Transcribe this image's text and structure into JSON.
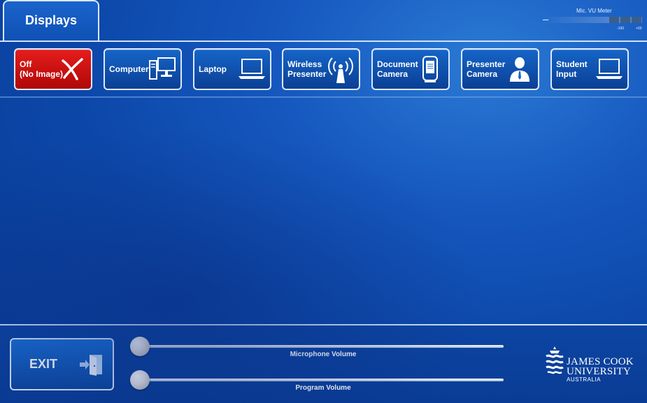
{
  "header": {
    "tab_label": "Displays"
  },
  "vu_meter": {
    "title": "Mic. VU Meter",
    "scale_labels": [
      "-100",
      "+00"
    ]
  },
  "sources": [
    {
      "label": "Off\n(No Image)",
      "icon": "x-icon",
      "active": true
    },
    {
      "label": "Computer",
      "icon": "desktop-computer-icon",
      "active": false
    },
    {
      "label": "Laptop",
      "icon": "laptop-icon",
      "active": false
    },
    {
      "label": "Wireless\nPresenter",
      "icon": "wireless-antenna-icon",
      "active": false
    },
    {
      "label": "Document\nCamera",
      "icon": "document-camera-icon",
      "active": false
    },
    {
      "label": "Presenter\nCamera",
      "icon": "presenter-person-icon",
      "active": false
    },
    {
      "label": "Student\nInput",
      "icon": "laptop-icon",
      "active": false
    }
  ],
  "exit_button": {
    "label": "EXIT",
    "icon": "exit-door-icon"
  },
  "sliders": {
    "microphone": {
      "label": "Microphone Volume",
      "level": 0.0
    },
    "program": {
      "label": "Program Volume",
      "level": 0.0
    }
  },
  "logo": {
    "line1": "JAMES COOK",
    "line2": "UNIVERSITY",
    "line3": "AUSTRALIA"
  },
  "colors": {
    "background": "#0c47a8",
    "button_blue": "#1565c8",
    "off_red": "#d41111",
    "border": "#dce9ff"
  }
}
